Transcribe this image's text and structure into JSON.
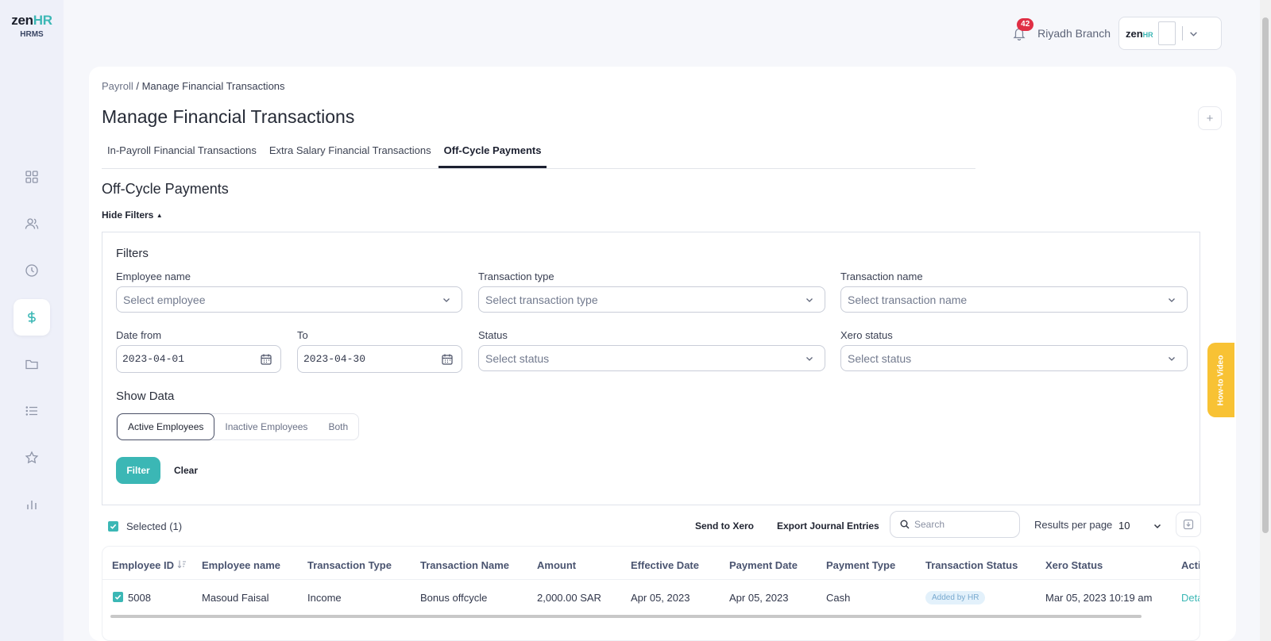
{
  "app": {
    "logo_main": "zen",
    "logo_accent": "HR",
    "logo_sub": "HRMS"
  },
  "header": {
    "notification_count": "42",
    "branch": "Riyadh Branch",
    "account_logo_main": "zen",
    "account_logo_accent": "HR"
  },
  "sidebar": {
    "items": [
      "dashboard-icon",
      "people-icon",
      "clock-icon",
      "dollar-icon",
      "folder-icon",
      "list-icon",
      "star-icon",
      "chart-icon"
    ],
    "active": "dollar-icon"
  },
  "breadcrumb": {
    "parent": "Payroll",
    "separator": " / ",
    "current": "Manage Financial Transactions"
  },
  "page": {
    "title": "Manage Financial Transactions",
    "add_button": "+"
  },
  "tabs": [
    {
      "label": "In-Payroll Financial Transactions"
    },
    {
      "label": "Extra Salary Financial Transactions"
    },
    {
      "label": "Off-Cycle Payments"
    }
  ],
  "section": {
    "title": "Off-Cycle Payments",
    "hide_filters": "Hide Filters"
  },
  "filters": {
    "heading": "Filters",
    "employee_label": "Employee name",
    "employee_placeholder": "Select employee",
    "type_label": "Transaction type",
    "type_placeholder": "Select transaction type",
    "name_label": "Transaction name",
    "name_placeholder": "Select transaction name",
    "date_from_label": "Date from",
    "date_from_value": "2023-04-01",
    "date_to_label": "To",
    "date_to_value": "2023-04-30",
    "status_label": "Status",
    "status_placeholder": "Select status",
    "xero_status_label": "Xero status",
    "xero_status_placeholder": "Select status",
    "show_data_label": "Show Data",
    "show_data_options": [
      "Active Employees",
      "Inactive Employees",
      "Both"
    ],
    "show_data_selected": "Active Employees",
    "filter_button": "Filter",
    "clear_button": "Clear"
  },
  "toolbar": {
    "selected_label": "Selected (1)",
    "send_to_xero": "Send to Xero",
    "export_journal": "Export Journal Entries",
    "search_placeholder": "Search",
    "results_per_page_label": "Results per page",
    "results_per_page_value": "10"
  },
  "table": {
    "columns": [
      "Employee ID",
      "Employee name",
      "Transaction Type",
      "Transaction Name",
      "Amount",
      "Effective Date",
      "Payment Date",
      "Payment Type",
      "Transaction Status",
      "Xero Status",
      "Acti"
    ],
    "rows": [
      {
        "employee_id": "5008",
        "employee_name": "Masoud Faisal",
        "transaction_type": "Income",
        "transaction_name": "Bonus offcycle",
        "amount": "2,000.00 SAR",
        "effective_date": "Apr 05, 2023",
        "payment_date": "Apr 05, 2023",
        "payment_type": "Cash",
        "transaction_status": "Added by HR",
        "xero_status": "Mar 05, 2023 10:19 am",
        "action": "Deta"
      }
    ]
  },
  "howto": {
    "label": "How-to Video"
  },
  "colors": {
    "accent": "#3bb7b5",
    "badge": "#e02f45",
    "howto": "#f8c234"
  }
}
